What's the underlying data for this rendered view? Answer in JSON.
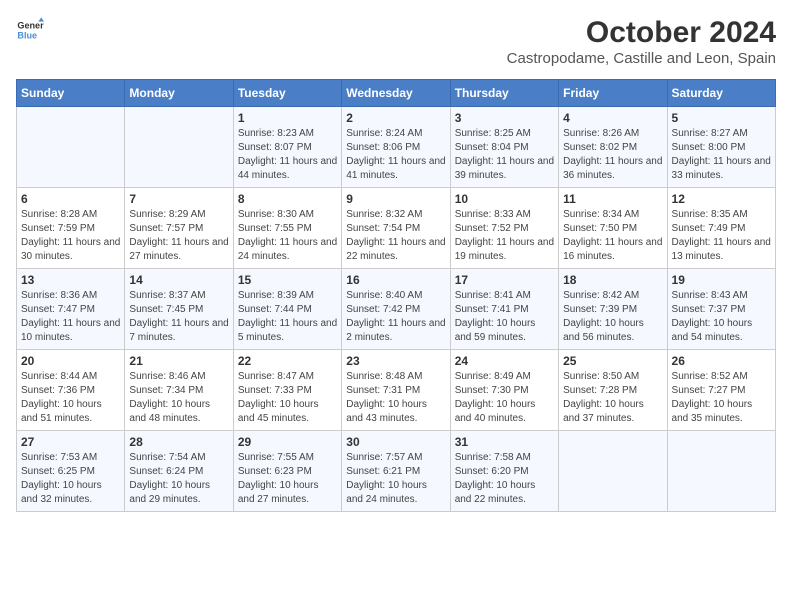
{
  "logo": {
    "line1": "General",
    "line2": "Blue"
  },
  "title": "October 2024",
  "subtitle": "Castropodame, Castille and Leon, Spain",
  "days_of_week": [
    "Sunday",
    "Monday",
    "Tuesday",
    "Wednesday",
    "Thursday",
    "Friday",
    "Saturday"
  ],
  "weeks": [
    [
      {
        "day": "",
        "info": ""
      },
      {
        "day": "",
        "info": ""
      },
      {
        "day": "1",
        "info": "Sunrise: 8:23 AM\nSunset: 8:07 PM\nDaylight: 11 hours and 44 minutes."
      },
      {
        "day": "2",
        "info": "Sunrise: 8:24 AM\nSunset: 8:06 PM\nDaylight: 11 hours and 41 minutes."
      },
      {
        "day": "3",
        "info": "Sunrise: 8:25 AM\nSunset: 8:04 PM\nDaylight: 11 hours and 39 minutes."
      },
      {
        "day": "4",
        "info": "Sunrise: 8:26 AM\nSunset: 8:02 PM\nDaylight: 11 hours and 36 minutes."
      },
      {
        "day": "5",
        "info": "Sunrise: 8:27 AM\nSunset: 8:00 PM\nDaylight: 11 hours and 33 minutes."
      }
    ],
    [
      {
        "day": "6",
        "info": "Sunrise: 8:28 AM\nSunset: 7:59 PM\nDaylight: 11 hours and 30 minutes."
      },
      {
        "day": "7",
        "info": "Sunrise: 8:29 AM\nSunset: 7:57 PM\nDaylight: 11 hours and 27 minutes."
      },
      {
        "day": "8",
        "info": "Sunrise: 8:30 AM\nSunset: 7:55 PM\nDaylight: 11 hours and 24 minutes."
      },
      {
        "day": "9",
        "info": "Sunrise: 8:32 AM\nSunset: 7:54 PM\nDaylight: 11 hours and 22 minutes."
      },
      {
        "day": "10",
        "info": "Sunrise: 8:33 AM\nSunset: 7:52 PM\nDaylight: 11 hours and 19 minutes."
      },
      {
        "day": "11",
        "info": "Sunrise: 8:34 AM\nSunset: 7:50 PM\nDaylight: 11 hours and 16 minutes."
      },
      {
        "day": "12",
        "info": "Sunrise: 8:35 AM\nSunset: 7:49 PM\nDaylight: 11 hours and 13 minutes."
      }
    ],
    [
      {
        "day": "13",
        "info": "Sunrise: 8:36 AM\nSunset: 7:47 PM\nDaylight: 11 hours and 10 minutes."
      },
      {
        "day": "14",
        "info": "Sunrise: 8:37 AM\nSunset: 7:45 PM\nDaylight: 11 hours and 7 minutes."
      },
      {
        "day": "15",
        "info": "Sunrise: 8:39 AM\nSunset: 7:44 PM\nDaylight: 11 hours and 5 minutes."
      },
      {
        "day": "16",
        "info": "Sunrise: 8:40 AM\nSunset: 7:42 PM\nDaylight: 11 hours and 2 minutes."
      },
      {
        "day": "17",
        "info": "Sunrise: 8:41 AM\nSunset: 7:41 PM\nDaylight: 10 hours and 59 minutes."
      },
      {
        "day": "18",
        "info": "Sunrise: 8:42 AM\nSunset: 7:39 PM\nDaylight: 10 hours and 56 minutes."
      },
      {
        "day": "19",
        "info": "Sunrise: 8:43 AM\nSunset: 7:37 PM\nDaylight: 10 hours and 54 minutes."
      }
    ],
    [
      {
        "day": "20",
        "info": "Sunrise: 8:44 AM\nSunset: 7:36 PM\nDaylight: 10 hours and 51 minutes."
      },
      {
        "day": "21",
        "info": "Sunrise: 8:46 AM\nSunset: 7:34 PM\nDaylight: 10 hours and 48 minutes."
      },
      {
        "day": "22",
        "info": "Sunrise: 8:47 AM\nSunset: 7:33 PM\nDaylight: 10 hours and 45 minutes."
      },
      {
        "day": "23",
        "info": "Sunrise: 8:48 AM\nSunset: 7:31 PM\nDaylight: 10 hours and 43 minutes."
      },
      {
        "day": "24",
        "info": "Sunrise: 8:49 AM\nSunset: 7:30 PM\nDaylight: 10 hours and 40 minutes."
      },
      {
        "day": "25",
        "info": "Sunrise: 8:50 AM\nSunset: 7:28 PM\nDaylight: 10 hours and 37 minutes."
      },
      {
        "day": "26",
        "info": "Sunrise: 8:52 AM\nSunset: 7:27 PM\nDaylight: 10 hours and 35 minutes."
      }
    ],
    [
      {
        "day": "27",
        "info": "Sunrise: 7:53 AM\nSunset: 6:25 PM\nDaylight: 10 hours and 32 minutes."
      },
      {
        "day": "28",
        "info": "Sunrise: 7:54 AM\nSunset: 6:24 PM\nDaylight: 10 hours and 29 minutes."
      },
      {
        "day": "29",
        "info": "Sunrise: 7:55 AM\nSunset: 6:23 PM\nDaylight: 10 hours and 27 minutes."
      },
      {
        "day": "30",
        "info": "Sunrise: 7:57 AM\nSunset: 6:21 PM\nDaylight: 10 hours and 24 minutes."
      },
      {
        "day": "31",
        "info": "Sunrise: 7:58 AM\nSunset: 6:20 PM\nDaylight: 10 hours and 22 minutes."
      },
      {
        "day": "",
        "info": ""
      },
      {
        "day": "",
        "info": ""
      }
    ]
  ]
}
